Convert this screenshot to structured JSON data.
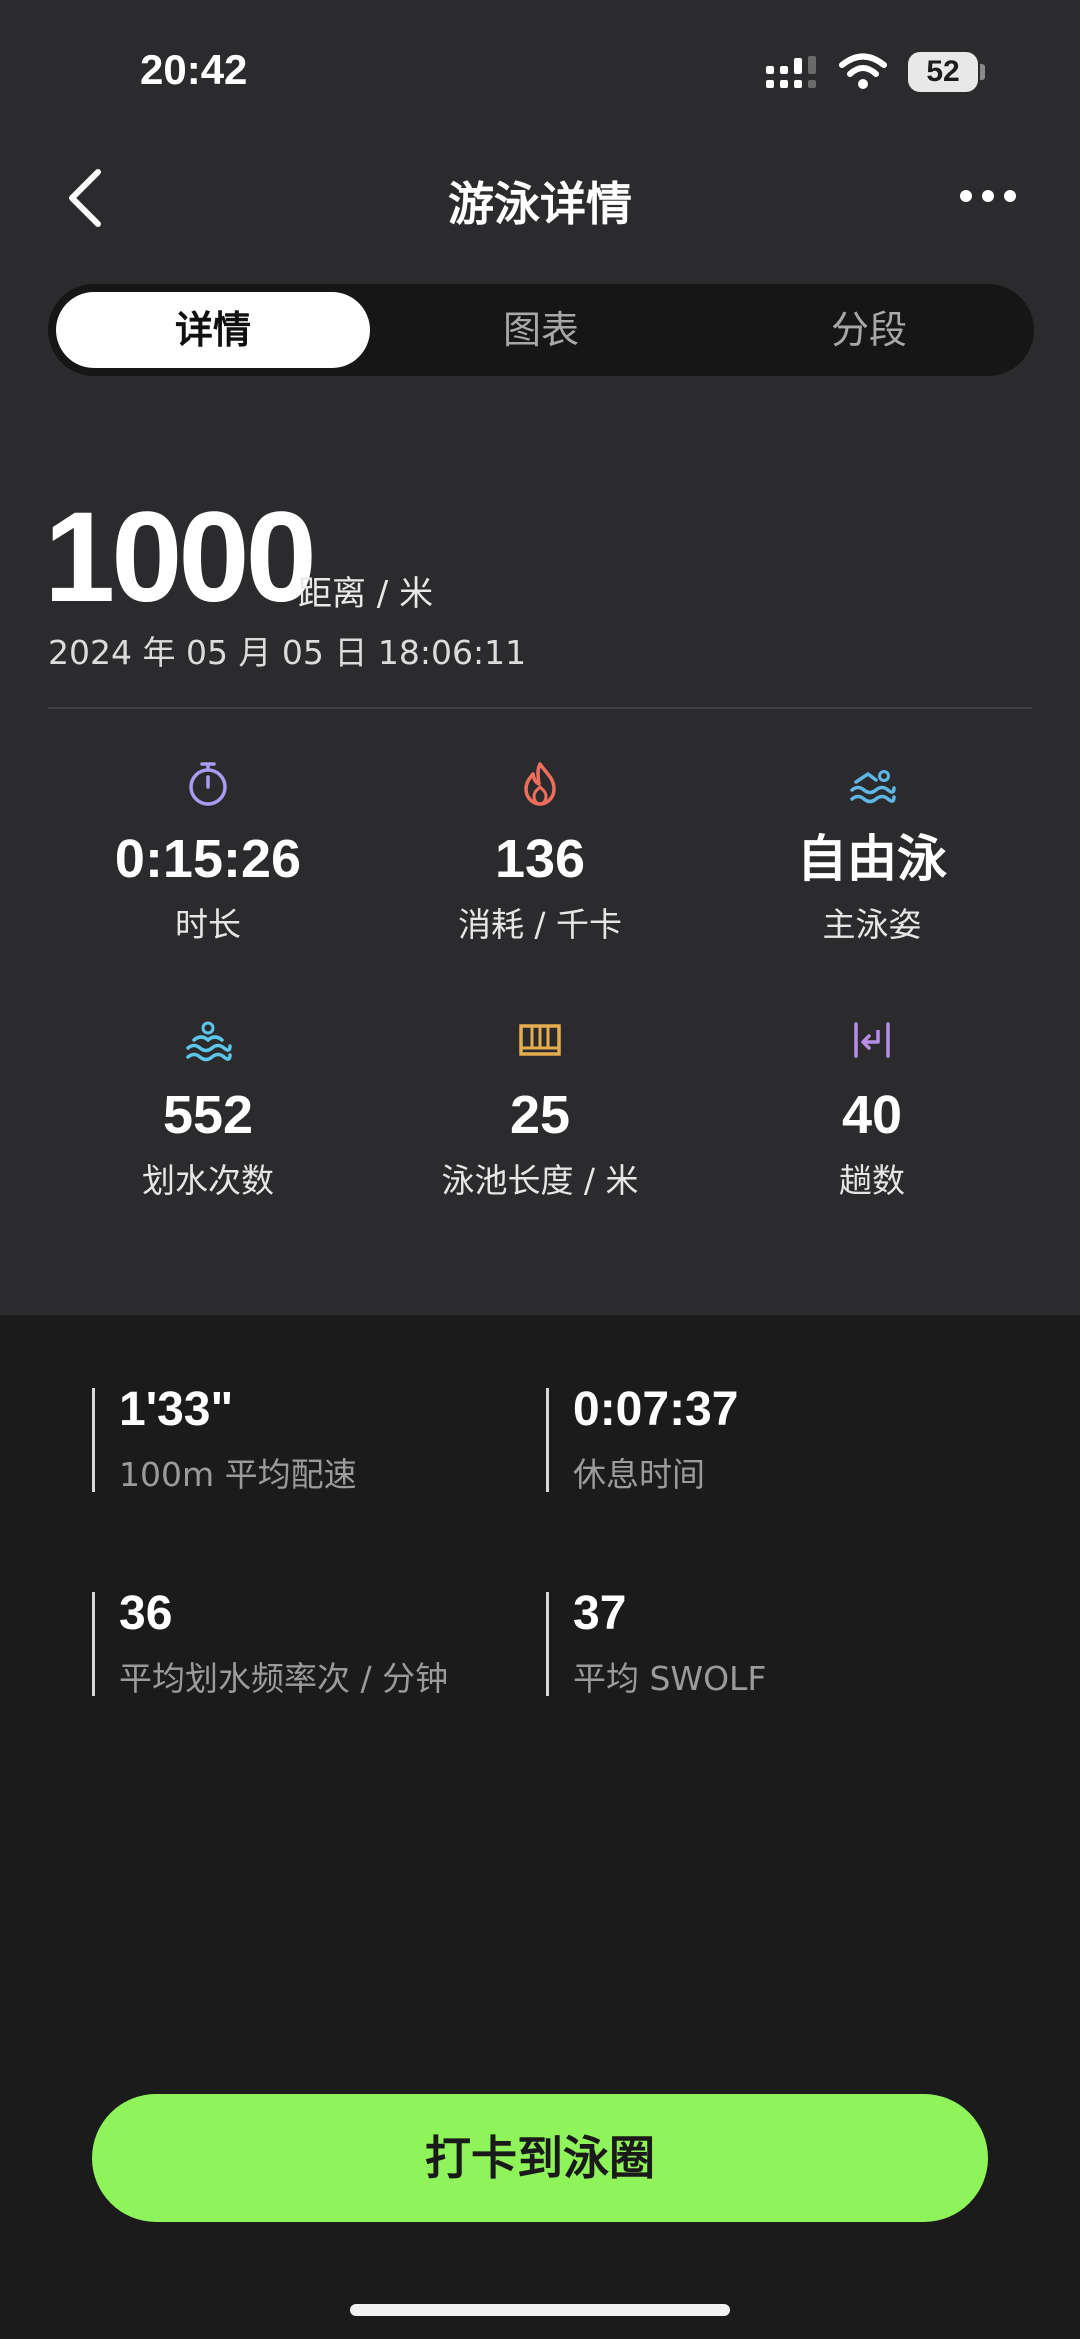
{
  "status_bar": {
    "time": "20:42",
    "battery": "52"
  },
  "header": {
    "title": "游泳详情"
  },
  "tabs": [
    {
      "label": "详情",
      "active": true
    },
    {
      "label": "图表",
      "active": false
    },
    {
      "label": "分段",
      "active": false
    }
  ],
  "summary": {
    "distance": "1000",
    "distance_unit": "距离 / 米",
    "datetime": "2024 年 05 月 05 日 18:06:11"
  },
  "metrics": [
    {
      "icon": "stopwatch-icon",
      "color": "#a99af2",
      "value": "0:15:26",
      "label": "时长"
    },
    {
      "icon": "flame-icon",
      "color": "#ef6f5c",
      "value": "136",
      "label": "消耗 / 千卡"
    },
    {
      "icon": "swimmer-icon",
      "color": "#5fb7e6",
      "value": "自由泳",
      "label": "主泳姿"
    },
    {
      "icon": "stroke-icon",
      "color": "#5cc7e8",
      "value": "552",
      "label": "划水次数"
    },
    {
      "icon": "pool-length-icon",
      "color": "#e4ad4f",
      "value": "25",
      "label": "泳池长度 / 米"
    },
    {
      "icon": "laps-icon",
      "color": "#b68ee8",
      "value": "40",
      "label": "趟数"
    }
  ],
  "stats": [
    {
      "value": "1'33\"",
      "label": "100m 平均配速"
    },
    {
      "value": "0:07:37",
      "label": "休息时间"
    },
    {
      "value": "36",
      "label": "平均划水频率次 / 分钟"
    },
    {
      "value": "37",
      "label": "平均 SWOLF"
    }
  ],
  "cta": {
    "label": "打卡到泳圈",
    "color": "#8ff35a"
  }
}
